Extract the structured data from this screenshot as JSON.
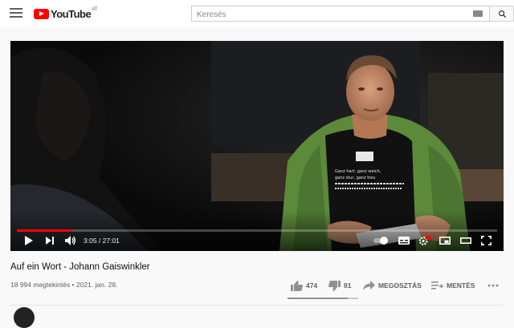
{
  "header": {
    "logo_text": "YouTube",
    "logo_country": "AT",
    "search_placeholder": "Keresés"
  },
  "player": {
    "current_time": "3:05",
    "duration": "27:01",
    "time_display": "3:05 / 27:01",
    "progress": 0.114,
    "shirt_text_1": "Ganz hart, ganz weich,",
    "shirt_text_2": "ganz stur, ganz treu"
  },
  "video": {
    "title": "Auf ein Wort - Johann Gaiswinkler",
    "views": "18 994 megtekintés",
    "date": "2021. jan. 28.",
    "meta_line": "18 994 megtekintés • 2021. jan. 28.",
    "likes": "474",
    "dislikes": "81",
    "like_ratio": 0.854,
    "share_label": "MEGOSZTÁS",
    "save_label": "MENTÉS"
  },
  "colors": {
    "brand_red": "#ff0000",
    "jacket_green": "#5c8a3a"
  },
  "icons": [
    "menu-icon",
    "youtube-logo-icon",
    "keyboard-icon",
    "search-icon",
    "play-icon",
    "next-icon",
    "volume-icon",
    "autoplay-toggle-icon",
    "subtitles-icon",
    "settings-icon",
    "miniplayer-icon",
    "theater-icon",
    "fullscreen-icon",
    "like-icon",
    "dislike-icon",
    "share-icon",
    "save-playlist-icon",
    "more-icon"
  ]
}
